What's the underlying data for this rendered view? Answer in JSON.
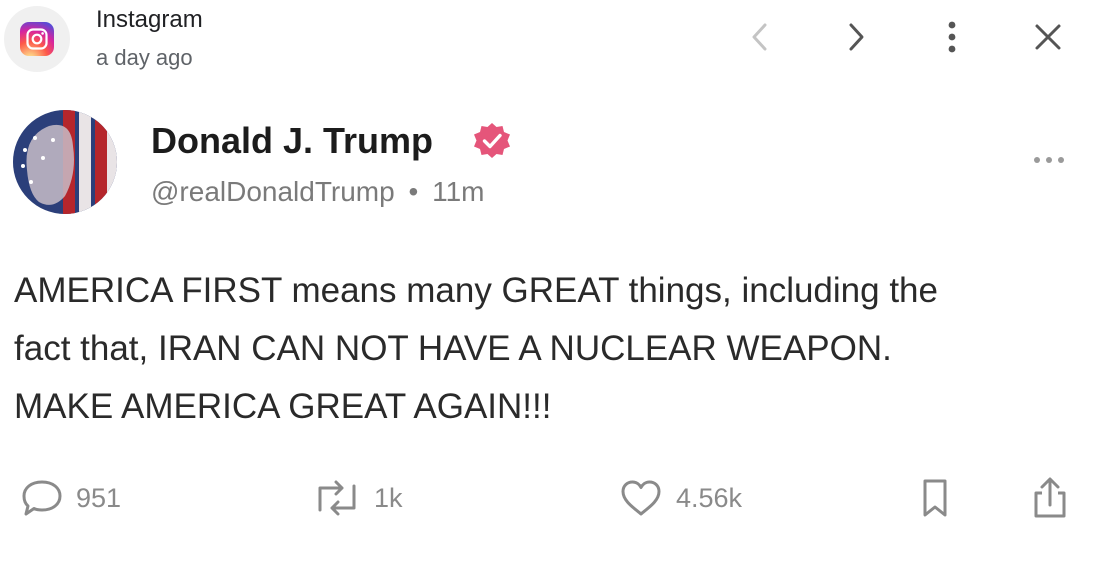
{
  "notification": {
    "app_name": "Instagram",
    "time": "a day ago",
    "app_icon": "instagram-icon",
    "controls": [
      "chevron-left-icon",
      "chevron-right-icon",
      "more-vertical-icon",
      "close-icon"
    ]
  },
  "post": {
    "author_name": "Donald J. Trump",
    "verified_icon": "verified-badge-icon",
    "handle": "@realDonaldTrump",
    "separator": "•",
    "age": "11m",
    "text": "AMERICA FIRST means many GREAT things, including the\nfact that, IRAN CAN NOT HAVE A NUCLEAR WEAPON.\nMAKE AMERICA GREAT AGAIN!!!",
    "actions": {
      "replies": "951",
      "reposts": "1k",
      "likes": "4.56k"
    }
  },
  "colors": {
    "verified": "#e5557a",
    "muted": "#8a8a8a",
    "text": "#2a2a2a"
  }
}
